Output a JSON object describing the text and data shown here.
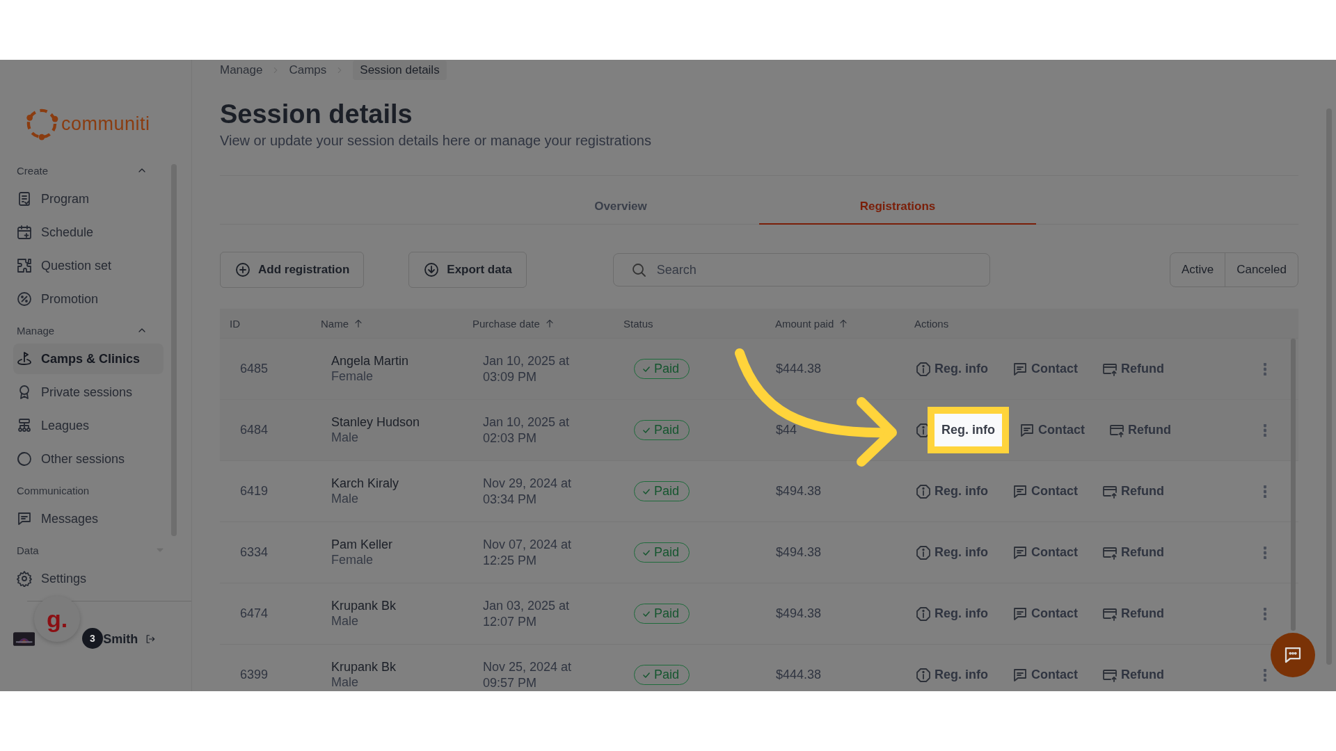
{
  "logo": {
    "text": "communiti"
  },
  "sidebar": {
    "sections": [
      {
        "title": "Create",
        "kind": "collapsible",
        "expanded": true,
        "items": [
          {
            "label": "Program",
            "selected": false
          },
          {
            "label": "Schedule",
            "selected": false
          },
          {
            "label": "Question set",
            "selected": false
          },
          {
            "label": "Promotion",
            "selected": false
          }
        ]
      },
      {
        "title": "Manage",
        "kind": "collapsible",
        "expanded": true,
        "items": [
          {
            "label": "Camps & Clinics",
            "selected": true
          },
          {
            "label": "Private sessions",
            "selected": false
          },
          {
            "label": "Leagues",
            "selected": false
          },
          {
            "label": "Other sessions",
            "selected": false
          }
        ]
      },
      {
        "title": "Communication",
        "kind": "plain",
        "items": [
          {
            "label": "Messages",
            "selected": false
          }
        ]
      },
      {
        "title": "Data",
        "kind": "collapsible",
        "expanded": false
      }
    ],
    "footer_items": [
      {
        "label": "Settings",
        "selected": false
      }
    ],
    "user": {
      "name": "Smith",
      "badge": "3",
      "widget": "g."
    }
  },
  "breadcrumb": [
    {
      "label": "Manage",
      "current": false
    },
    {
      "label": "Camps",
      "current": false
    },
    {
      "label": "Session details",
      "current": true
    }
  ],
  "page": {
    "title": "Session details",
    "subtitle": "View or update your session details here or manage your registrations"
  },
  "tabs": [
    {
      "label": "Overview",
      "selected": false
    },
    {
      "label": "Registrations",
      "selected": true
    }
  ],
  "toolbar": {
    "buttons": [
      {
        "label": "Add registration"
      },
      {
        "label": "Export data"
      }
    ],
    "search": {
      "placeholder": "Search"
    },
    "filters": [
      {
        "label": "Active",
        "selected": false
      },
      {
        "label": "Canceled",
        "selected": false
      }
    ]
  },
  "table": {
    "columns": [
      {
        "label": "ID",
        "sortable": false
      },
      {
        "label": "Name",
        "sortable": true
      },
      {
        "label": "Purchase date",
        "sortable": true
      },
      {
        "label": "Status",
        "sortable": false
      },
      {
        "label": "Amount paid",
        "sortable": true
      },
      {
        "label": "Actions",
        "sortable": false
      }
    ],
    "rows": [
      {
        "id": "6485",
        "name": "Angela Martin",
        "gender": "Female",
        "date": "Jan 10, 2025 at 03:09 PM",
        "status": "Paid",
        "amount": "$444.38",
        "actions": [
          {
            "label": "Reg. info",
            "highlighted": false
          },
          {
            "label": "Contact",
            "highlighted": false
          },
          {
            "label": "Refund",
            "highlighted": false
          }
        ]
      },
      {
        "id": "6484",
        "name": "Stanley Hudson",
        "gender": "Male",
        "date": "Jan 10, 2025 at 02:03 PM",
        "status": "Paid",
        "amount": "$44",
        "actions": [
          {
            "label": "Reg. info",
            "highlighted": true
          },
          {
            "label": "Contact",
            "highlighted": false
          },
          {
            "label": "Refund",
            "highlighted": false
          }
        ]
      },
      {
        "id": "6419",
        "name": "Karch Kiraly",
        "gender": "Male",
        "date": "Nov 29, 2024 at 03:34 PM",
        "status": "Paid",
        "amount": "$494.38",
        "actions": [
          {
            "label": "Reg. info",
            "highlighted": false
          },
          {
            "label": "Contact",
            "highlighted": false
          },
          {
            "label": "Refund",
            "highlighted": false
          }
        ]
      },
      {
        "id": "6334",
        "name": "Pam Keller",
        "gender": "Female",
        "date": "Nov 07, 2024 at 12:25 PM",
        "status": "Paid",
        "amount": "$494.38",
        "actions": [
          {
            "label": "Reg. info",
            "highlighted": false
          },
          {
            "label": "Contact",
            "highlighted": false
          },
          {
            "label": "Refund",
            "highlighted": false
          }
        ]
      },
      {
        "id": "6474",
        "name": "Krupank Bk",
        "gender": "Male",
        "date": "Jan 03, 2025 at 12:07 PM",
        "status": "Paid",
        "amount": "$494.38",
        "actions": [
          {
            "label": "Reg. info",
            "highlighted": false
          },
          {
            "label": "Contact",
            "highlighted": false
          },
          {
            "label": "Refund",
            "highlighted": false
          }
        ]
      },
      {
        "id": "6399",
        "name": "Krupank Bk",
        "gender": "Male",
        "date": "Nov 25, 2024 at 09:57 PM",
        "status": "Paid",
        "amount": "$444.38",
        "actions": [
          {
            "label": "Reg. info",
            "highlighted": false
          },
          {
            "label": "Contact",
            "highlighted": false
          },
          {
            "label": "Refund",
            "highlighted": false
          }
        ]
      }
    ]
  }
}
